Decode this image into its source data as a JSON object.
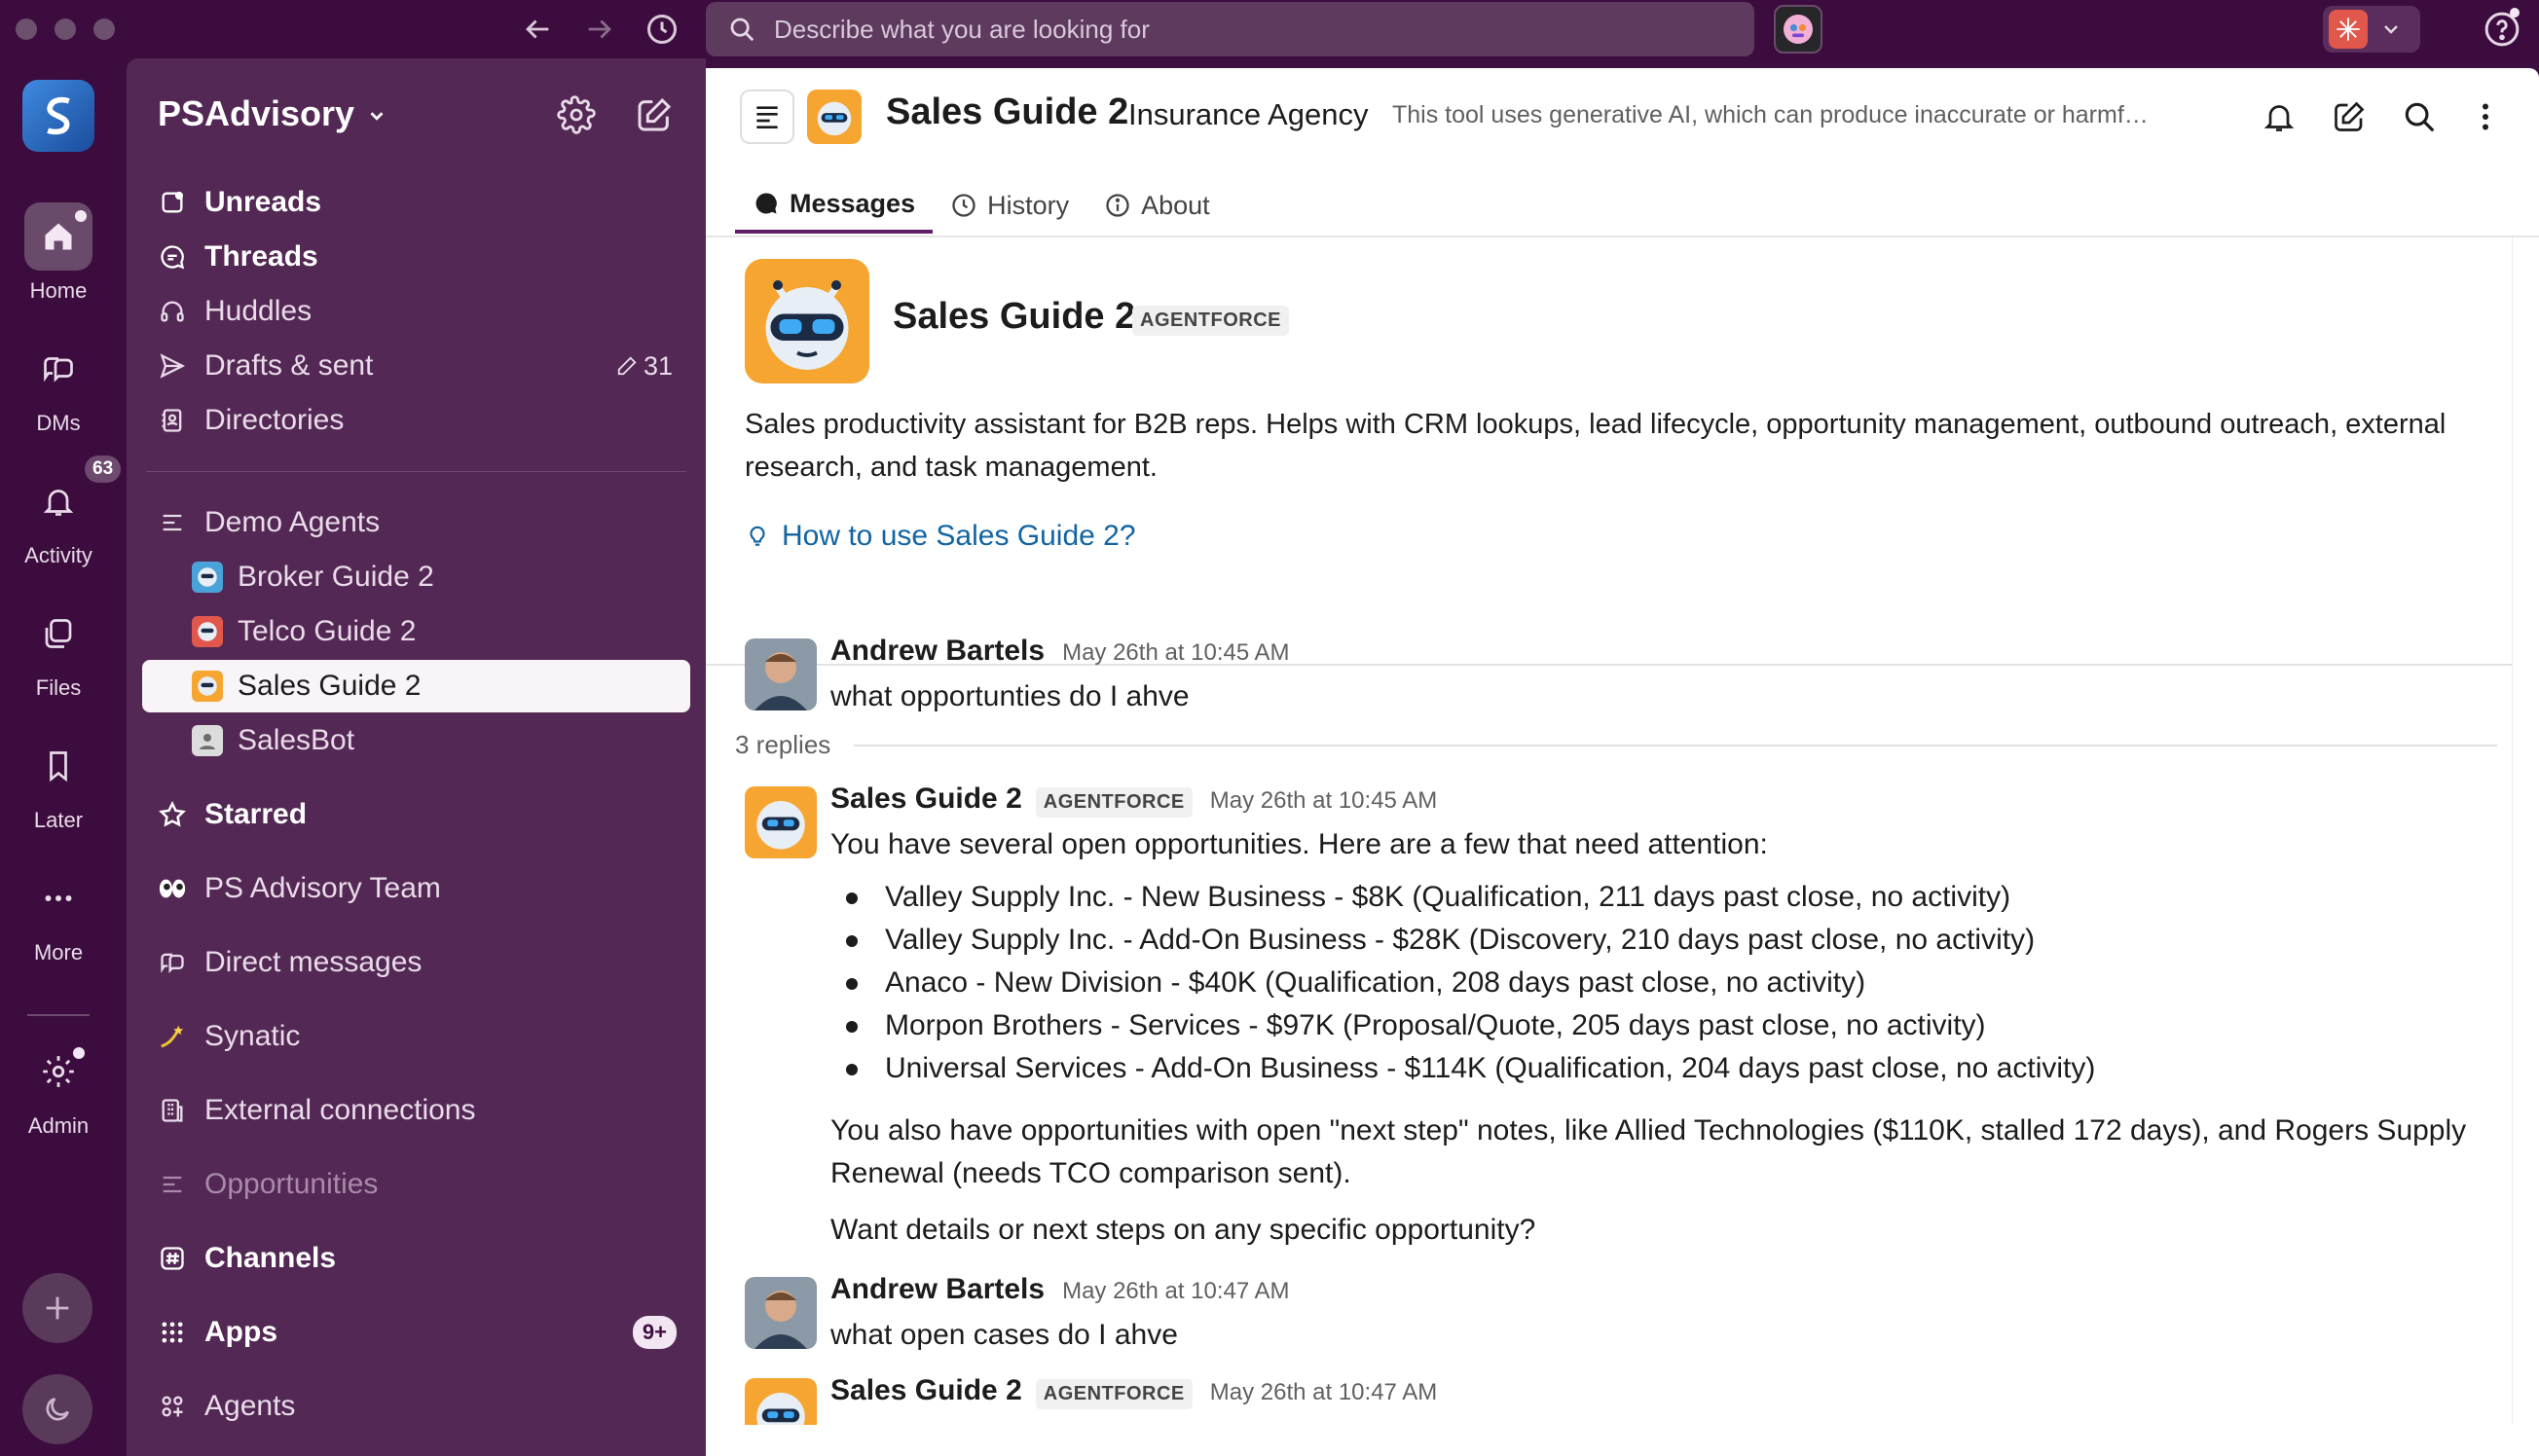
{
  "search": {
    "placeholder": "Describe what you are looking for"
  },
  "rail": {
    "items": [
      {
        "label": "Home"
      },
      {
        "label": "DMs"
      },
      {
        "label": "Activity",
        "badge": "63"
      },
      {
        "label": "Files"
      },
      {
        "label": "Later"
      },
      {
        "label": "More"
      },
      {
        "label": "Admin"
      }
    ]
  },
  "sidebar": {
    "workspace": "PSAdvisory",
    "nav": [
      {
        "label": "Unreads"
      },
      {
        "label": "Threads"
      },
      {
        "label": "Huddles"
      },
      {
        "label": "Drafts & sent",
        "count": "31"
      },
      {
        "label": "Directories"
      }
    ],
    "demo_agents": {
      "label": "Demo Agents",
      "items": [
        {
          "label": "Broker Guide 2"
        },
        {
          "label": "Telco Guide 2"
        },
        {
          "label": "Sales Guide 2"
        },
        {
          "label": "SalesBot"
        }
      ]
    },
    "sections": [
      {
        "label": "Starred"
      },
      {
        "label": "PS Advisory Team"
      },
      {
        "label": "Direct messages"
      },
      {
        "label": "Synatic"
      },
      {
        "label": "External connections"
      },
      {
        "label": "Opportunities"
      },
      {
        "label": "Channels"
      },
      {
        "label": "Apps",
        "badge": "9+"
      },
      {
        "label": "Agents"
      }
    ]
  },
  "channel": {
    "title": "Sales Guide 2",
    "subtitle": "Insurance Agency",
    "description": "This tool uses generative AI, which can produce inaccurate or harmf…",
    "tabs": [
      {
        "label": "Messages"
      },
      {
        "label": "History"
      },
      {
        "label": "About"
      }
    ]
  },
  "intro": {
    "name": "Sales Guide 2",
    "tag": "AGENTFORCE",
    "description": "Sales productivity assistant for B2B reps. Helps with CRM lookups, lead lifecycle, opportunity management, outbound outreach, external research, and task management.",
    "link": "How to use Sales Guide 2?"
  },
  "messages": [
    {
      "author": "Andrew Bartels",
      "time": "May 26th at 10:45 AM",
      "text": "what opportunties do I ahve"
    },
    {
      "author": "Sales Guide 2",
      "tag": "AGENTFORCE",
      "time": "May 26th at 10:45 AM",
      "text": "You have several open opportunities. Here are a few that need attention:",
      "bullets": [
        "Valley Supply Inc. - New Business - $8K (Qualification, 211 days past close, no activity)",
        "Valley Supply Inc. - Add-On Business - $28K (Discovery, 210 days past close, no activity)",
        "Anaco - New Division - $40K (Qualification, 208 days past close, no activity)",
        "Morpon Brothers - Services - $97K (Proposal/Quote, 205 days past close, no activity)",
        "Universal Services - Add-On Business - $114K (Qualification, 204 days past close, no activity)"
      ],
      "text2": "You also have opportunities with open \"next step\" notes, like Allied Technologies ($110K, stalled 172 days), and Rogers Supply Renewal (needs TCO comparison sent).",
      "text3": "Want details or next steps on any specific opportunity?"
    },
    {
      "author": "Andrew Bartels",
      "time": "May 26th at 10:47 AM",
      "text": "what open cases do I ahve"
    },
    {
      "author": "Sales Guide 2",
      "tag": "AGENTFORCE",
      "time": "May 26th at 10:47 AM"
    }
  ],
  "replies": "3 replies",
  "colors": {
    "aubergine": "#3f0e40",
    "sidebar": "#532854",
    "link": "#1264a3",
    "tab_underline": "#611f69"
  }
}
